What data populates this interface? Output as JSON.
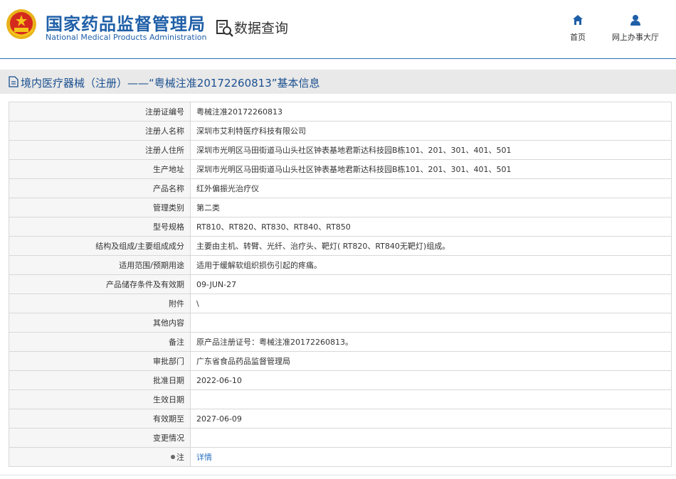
{
  "header": {
    "title_cn": "国家药品监督管理局",
    "title_en": "National Medical Products Administration",
    "query_label": "数据查询",
    "nav": [
      {
        "label": "首页",
        "icon": "home-icon"
      },
      {
        "label": "网上办事大厅",
        "icon": "user-icon"
      }
    ]
  },
  "page": {
    "title": "境内医疗器械（注册）——“粤械注准20172260813”基本信息"
  },
  "rows": [
    {
      "label": "注册证编号",
      "value": "粤械注准20172260813"
    },
    {
      "label": "注册人名称",
      "value": "深圳市艾利特医疗科技有限公司"
    },
    {
      "label": "注册人住所",
      "value": "深圳市光明区马田街道马山头社区钟表基地君斯达科技园B栋101、201、301、401、501"
    },
    {
      "label": "生产地址",
      "value": "深圳市光明区马田街道马山头社区钟表基地君斯达科技园B栋101、201、301、401、501"
    },
    {
      "label": "产品名称",
      "value": "红外偏振光治疗仪"
    },
    {
      "label": "管理类别",
      "value": "第二类"
    },
    {
      "label": "型号规格",
      "value": "RT810、RT820、RT830、RT840、RT850"
    },
    {
      "label": "结构及组成/主要组成成分",
      "value": "主要由主机、转臂、光纤、治疗头、靶灯( RT820、RT840无靶灯)组成。"
    },
    {
      "label": "适用范围/预期用途",
      "value": "适用于缓解软组织损伤引起的疼痛。"
    },
    {
      "label": "产品储存条件及有效期",
      "value": "09-JUN-27"
    },
    {
      "label": "附件",
      "value": "\\"
    },
    {
      "label": "其他内容",
      "value": ""
    },
    {
      "label": "备注",
      "value": "原产品注册证号：粤械注准20172260813。"
    },
    {
      "label": "审批部门",
      "value": "广东省食品药品监督管理局"
    },
    {
      "label": "批准日期",
      "value": "2022-06-10"
    },
    {
      "label": "生效日期",
      "value": ""
    },
    {
      "label": "有效期至",
      "value": "2027-06-09"
    },
    {
      "label": "变更情况",
      "value": ""
    }
  ],
  "note_row": {
    "label": "注",
    "link": "详情"
  },
  "colors": {
    "brand": "#1f5fa8",
    "link": "#2a6fc0",
    "label_bg": "#f6f6f6",
    "titlebar_bg": "#e9e9e9"
  }
}
